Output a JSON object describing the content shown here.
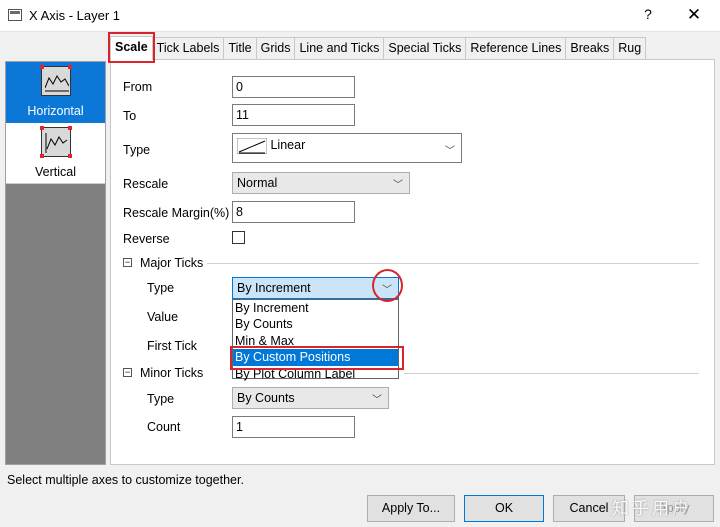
{
  "window": {
    "title": "X Axis - Layer 1",
    "help_label": "?",
    "close_label": "✕"
  },
  "tabs": [
    {
      "label": "Scale"
    },
    {
      "label": "Tick Labels"
    },
    {
      "label": "Title"
    },
    {
      "label": "Grids"
    },
    {
      "label": "Line and Ticks"
    },
    {
      "label": "Special Ticks"
    },
    {
      "label": "Reference Lines"
    },
    {
      "label": "Breaks"
    },
    {
      "label": "Rug"
    }
  ],
  "axes": [
    {
      "label": "Horizontal",
      "icon": "horizontal-axis-icon"
    },
    {
      "label": "Vertical",
      "icon": "vertical-axis-icon"
    }
  ],
  "scale": {
    "from_label": "From",
    "from_value": "0",
    "to_label": "To",
    "to_value": "11",
    "type_label": "Type",
    "type_value": "Linear",
    "rescale_label": "Rescale",
    "rescale_value": "Normal",
    "margin_label": "Rescale Margin(%)",
    "margin_value": "8",
    "reverse_label": "Reverse"
  },
  "major_ticks": {
    "section_label": "Major Ticks",
    "type_label": "Type",
    "type_value": "By Increment",
    "value_label": "Value",
    "first_tick_label": "First Tick",
    "options": [
      "By Increment",
      "By Counts",
      "Min & Max",
      "By Custom Positions",
      "By Plot Column Label"
    ],
    "highlighted_option": "By Custom Positions"
  },
  "minor_ticks": {
    "section_label": "Minor Ticks",
    "type_label": "Type",
    "type_value": "By Counts",
    "count_label": "Count",
    "count_value": "1"
  },
  "status": "Select multiple axes to customize together.",
  "buttons": {
    "apply_to": "Apply To...",
    "ok": "OK",
    "cancel": "Cancel",
    "apply": "Apply"
  },
  "watermark": "知乎用户",
  "colors": {
    "accent": "#0078d7",
    "highlight_red": "#d9242d",
    "selected_axis": "#0b78d7"
  }
}
